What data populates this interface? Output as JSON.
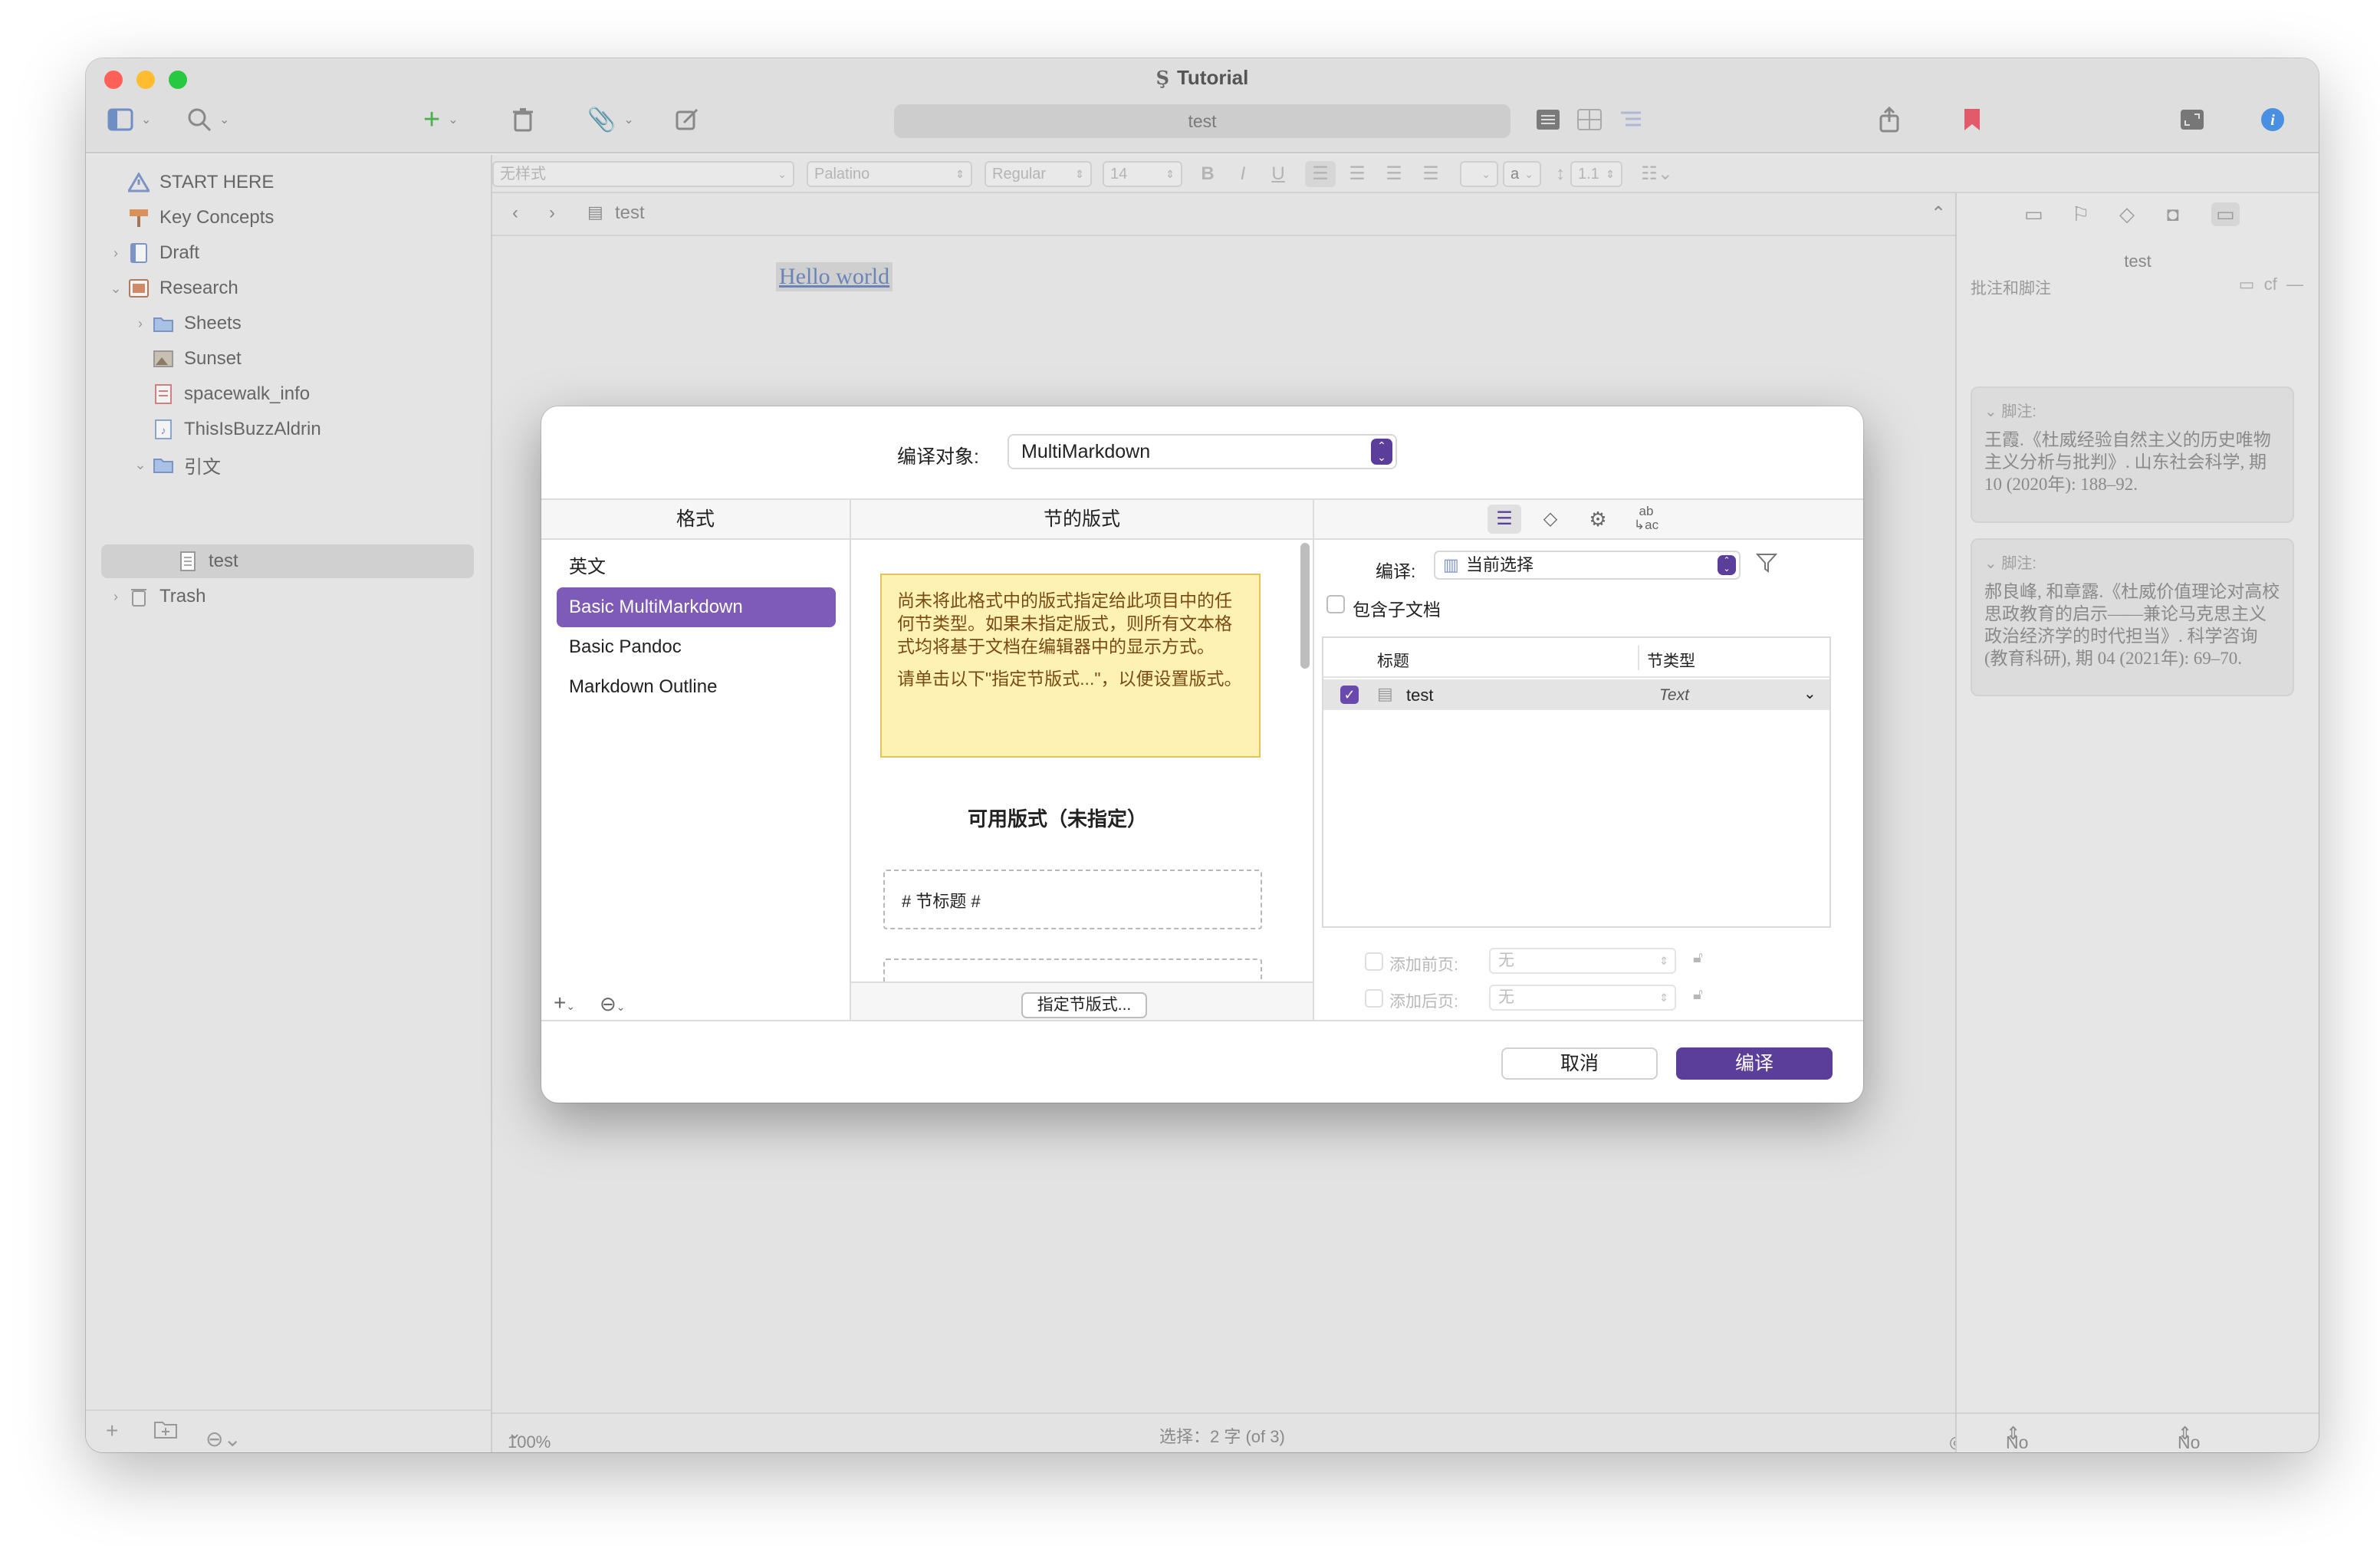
{
  "window": {
    "title": "Tutorial",
    "traffic_colors": [
      "#fe5f57",
      "#febc2e",
      "#28c840"
    ]
  },
  "toolbar": {
    "search_text": "test"
  },
  "format_bar": {
    "style": "无样式",
    "font": "Palatino",
    "weight": "Regular",
    "size": "14",
    "bold": "B",
    "italic": "I",
    "underline": "U",
    "text_color": "a",
    "line_spacing": "1.1"
  },
  "binder": {
    "items": [
      {
        "label": "START HERE",
        "icon": "warning-icon"
      },
      {
        "label": "Key Concepts",
        "icon": "signpost-icon"
      },
      {
        "label": "Draft",
        "icon": "manuscript-icon"
      },
      {
        "label": "Research",
        "icon": "research-folder-icon"
      },
      {
        "label": "Sheets",
        "icon": "folder-icon"
      },
      {
        "label": "Sunset",
        "icon": "image-icon"
      },
      {
        "label": "spacewalk_info",
        "icon": "pdf-icon"
      },
      {
        "label": "ThisIsBuzzAldrin",
        "icon": "audio-icon"
      },
      {
        "label": "引文",
        "icon": "folder-icon"
      },
      {
        "label": "test",
        "icon": "document-icon"
      },
      {
        "label": "Trash",
        "icon": "trash-icon"
      }
    ]
  },
  "editor": {
    "doc_title": "test",
    "content": "Hello world",
    "zoom": "100%",
    "status": "选择：2 字 (of 3)"
  },
  "inspector": {
    "title": "test",
    "section": "批注和脚注",
    "section_right": "cf",
    "footnote_label": "脚注:",
    "footnotes": [
      "王霞.《杜威经验自然主义的历史唯物主义分析与批判》. 山东社会科学, 期 10 (2020年): 188–92.",
      "郝良峰, 和章露.《杜威价值理论对高校思政教育的启示——兼论马克思主义政治经济学的时代担当》. 科学咨询(教育科研), 期 04 (2021年): 69–70."
    ],
    "label": "No Label",
    "status": "No Status"
  },
  "dialog": {
    "compile_for_label": "编译对象:",
    "compile_for_value": "MultiMarkdown",
    "col_formats": "格式",
    "col_section_layouts": "节的版式",
    "formats": [
      "英文",
      "Basic MultiMarkdown",
      "Basic Pandoc",
      "Markdown Outline"
    ],
    "selected_format_index": 1,
    "note_p1": "尚未将此格式中的版式指定给此项目中的任何节类型。如果未指定版式，则所有文本格式均将基于文档在编辑器中的显示方式。",
    "note_p2": "请单击以下\"指定节版式...\"，以便设置版式。",
    "available_layouts": "可用版式（未指定）",
    "layout_example": "#  节标题  #",
    "assign_button": "指定节版式...",
    "compile_label": "编译:",
    "compile_value": "当前选择",
    "include_subdocs": "包含子文档",
    "table_headers": {
      "title": "标题",
      "type": "节类型"
    },
    "table_rows": [
      {
        "title": "test",
        "type": "Text",
        "checked": true
      }
    ],
    "add_front": "添加前页:",
    "add_back": "添加后页:",
    "front_value": "无",
    "back_value": "无",
    "cancel": "取消",
    "compile": "编译",
    "accent": "#5b3e9a"
  }
}
